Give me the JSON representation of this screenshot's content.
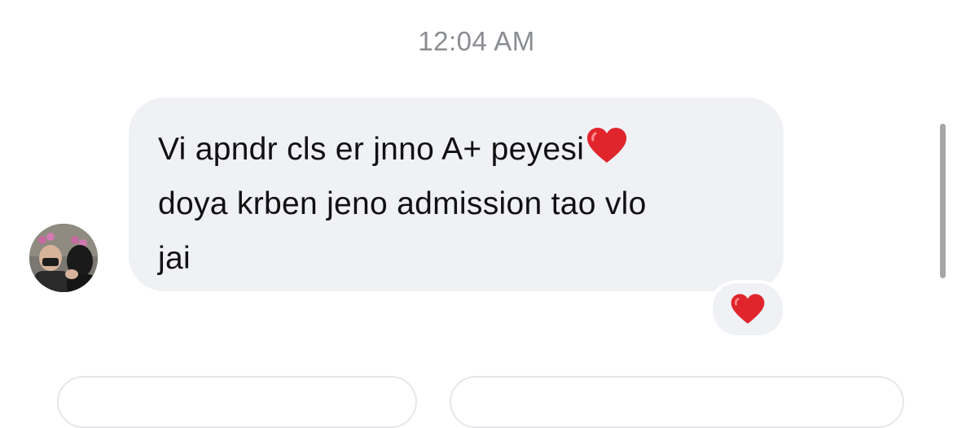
{
  "timestamp": "12:04 AM",
  "message": {
    "lines": [
      "Vi apndr cls er jnno A+ peyesi",
      "doya krben jeno admission tao vlo",
      "jai"
    ],
    "inline_emoji": "red-heart",
    "reaction": "red-heart"
  },
  "colors": {
    "bubble": "#f0f1f5",
    "timestamp": "#8a8d91",
    "heart": "#e0252c"
  }
}
